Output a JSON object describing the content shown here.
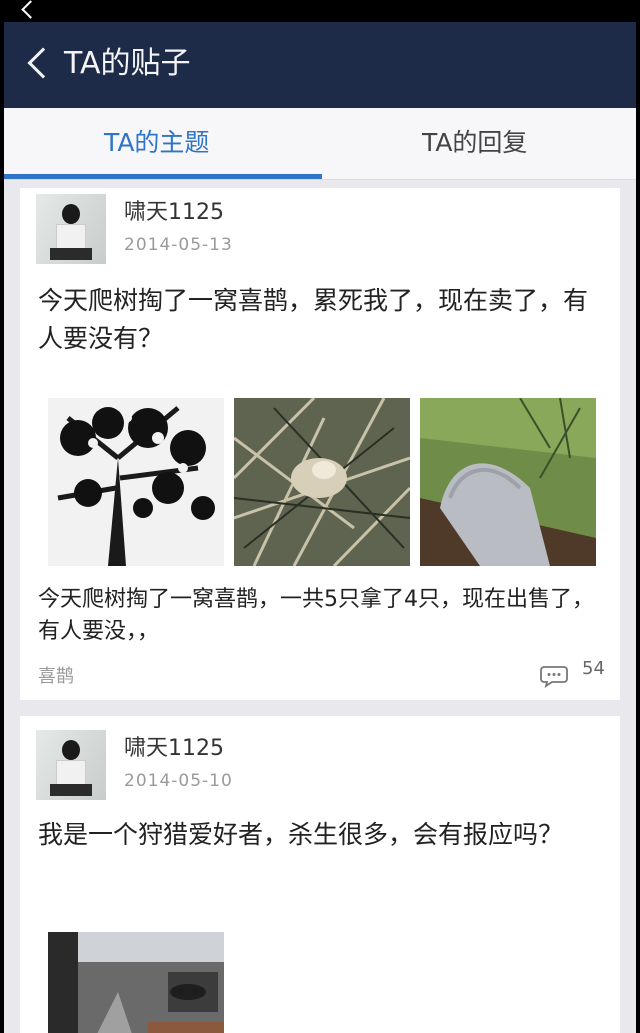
{
  "header": {
    "title": "TA的贴子"
  },
  "tabs": [
    {
      "label": "TA的主题",
      "active": true
    },
    {
      "label": "TA的回复",
      "active": false
    }
  ],
  "colors": {
    "nav_bg": "#1d2a48",
    "accent": "#2f74c9",
    "card_bg": "#ffffff",
    "page_bg": "#e9e9ed"
  },
  "posts": [
    {
      "username": "啸天1125",
      "date": "2014-05-13",
      "title": "今天爬树掏了一窝喜鹊，累死我了，现在卖了，有人要没有？",
      "photos": 3,
      "body": "今天爬树掏了一窝喜鹊，一共5只拿了4只，现在出售了，有人要没，，",
      "tag": "喜鹊",
      "comment_count": "54"
    },
    {
      "username": "啸天1125",
      "date": "2014-05-10",
      "title": "我是一个狩猎爱好者，杀生很多，会有报应吗？"
    }
  ],
  "icons": {
    "back": "chevron-left-icon",
    "comment": "speech-bubble-icon"
  }
}
